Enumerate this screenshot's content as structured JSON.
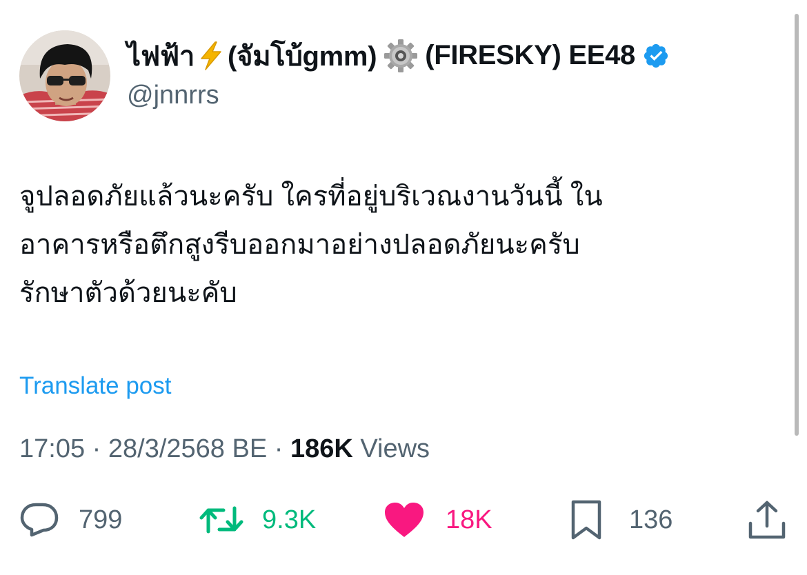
{
  "author": {
    "name_part1": "ไฟฟ้า",
    "name_part2": "(จัมโบ้gmm)",
    "name_part3": "(FIRESKY) EE48",
    "handle": "@jnnrrs",
    "emoji_1": "high-voltage-emoji",
    "emoji_2": "gear-emoji",
    "verified": true
  },
  "tweet": {
    "text": "จูปลอดภัยแล้วนะครับ ใครที่อยู่บริเวณงานวันนี้ ใน\nอาคารหรือตึกสูงรีบออกมาอย่างปลอดภัยนะครับ\nรักษาตัวด้วยนะคับ",
    "translate_label": "Translate post"
  },
  "meta": {
    "time": "17:05",
    "separator": "·",
    "date": "28/3/2568 BE",
    "views_count": "186K",
    "views_label": "Views"
  },
  "actions": {
    "replies": "799",
    "retweets": "9.3K",
    "likes": "18K",
    "bookmarks": "136"
  },
  "colors": {
    "text": "#0f1419",
    "secondary": "#536471",
    "link": "#1d9bf0",
    "retweet": "#00ba7c",
    "like": "#f91880",
    "verified": "#1d9bf0"
  }
}
